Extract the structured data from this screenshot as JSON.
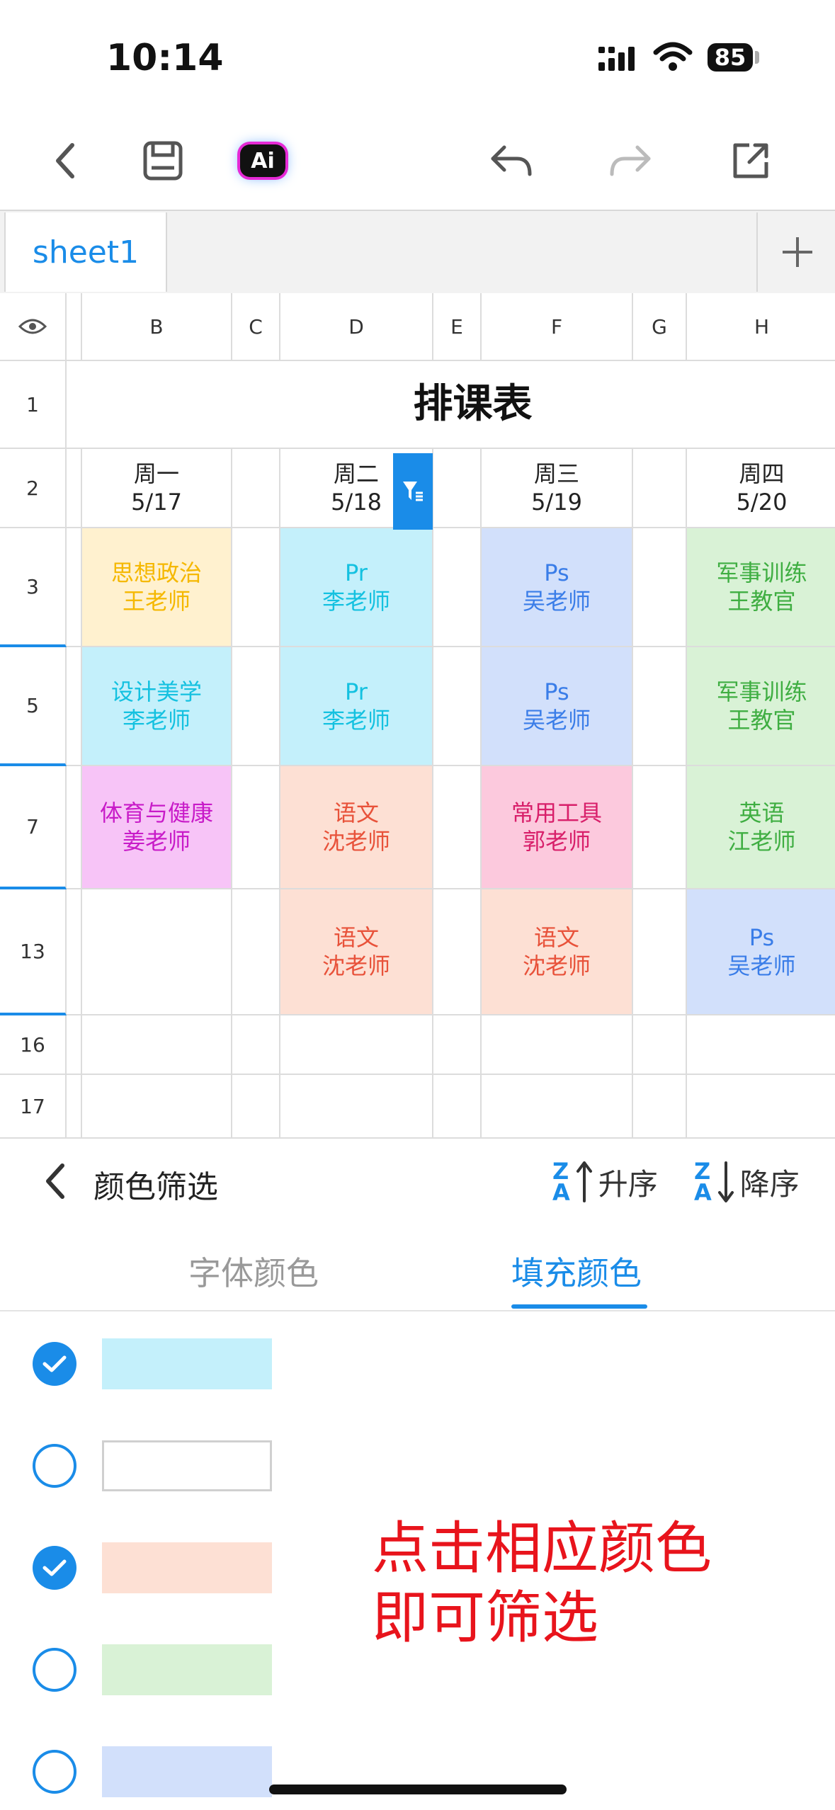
{
  "status": {
    "time": "10:14",
    "battery": "85"
  },
  "toolbar": {
    "ai_label": "Ai"
  },
  "sheet": {
    "tab_name": "sheet1"
  },
  "colors": {
    "accent": "#1a8ce8",
    "hint": "#e8141c"
  },
  "grid": {
    "columns": [
      "B",
      "C",
      "D",
      "E",
      "F",
      "G",
      "H"
    ],
    "rows": [
      "1",
      "2",
      "3",
      "5",
      "7",
      "13",
      "16",
      "17"
    ],
    "title": "排课表",
    "days": [
      {
        "day": "周一",
        "date": "5/17"
      },
      {
        "day": "周二",
        "date": "5/18"
      },
      {
        "day": "周三",
        "date": "5/19"
      },
      {
        "day": "周四",
        "date": "5/20"
      }
    ],
    "cells": {
      "r3": [
        {
          "course": "思想政治",
          "teacher": "王老师",
          "bg": "#fff1cf",
          "fg": "#f5b800"
        },
        {
          "course": "Pr",
          "teacher": "李老师",
          "bg": "#c4f0fb",
          "fg": "#14c1e0"
        },
        {
          "course": "Ps",
          "teacher": "吴老师",
          "bg": "#d2e0fb",
          "fg": "#3a7de8"
        },
        {
          "course": "军事训练",
          "teacher": "王教官",
          "bg": "#d9f2d6",
          "fg": "#3fae42"
        }
      ],
      "r5": [
        {
          "course": "设计美学",
          "teacher": "李老师",
          "bg": "#c4f0fb",
          "fg": "#14c1e0"
        },
        {
          "course": "Pr",
          "teacher": "李老师",
          "bg": "#c4f0fb",
          "fg": "#14c1e0"
        },
        {
          "course": "Ps",
          "teacher": "吴老师",
          "bg": "#d2e0fb",
          "fg": "#3a7de8"
        },
        {
          "course": "军事训练",
          "teacher": "王教官",
          "bg": "#d9f2d6",
          "fg": "#3fae42"
        }
      ],
      "r7": [
        {
          "course": "体育与健康",
          "teacher": "姜老师",
          "bg": "#f7c4f7",
          "fg": "#c81bc8"
        },
        {
          "course": "语文",
          "teacher": "沈老师",
          "bg": "#fde0d4",
          "fg": "#e8523a"
        },
        {
          "course": "常用工具",
          "teacher": "郭老师",
          "bg": "#fcc9dd",
          "fg": "#d81f6a"
        },
        {
          "course": "英语",
          "teacher": "江老师",
          "bg": "#d9f2d6",
          "fg": "#3fae42"
        }
      ],
      "r13": [
        {
          "course": "",
          "teacher": "",
          "bg": "#ffffff",
          "fg": "#333333"
        },
        {
          "course": "语文",
          "teacher": "沈老师",
          "bg": "#fde0d4",
          "fg": "#e8523a"
        },
        {
          "course": "语文",
          "teacher": "沈老师",
          "bg": "#fde0d4",
          "fg": "#e8523a"
        },
        {
          "course": "Ps",
          "teacher": "吴老师",
          "bg": "#d2e0fb",
          "fg": "#3a7de8"
        }
      ]
    }
  },
  "panel": {
    "title": "颜色筛选",
    "sort_asc": "升序",
    "sort_desc": "降序",
    "sort_icon_top": "Z",
    "sort_icon_bottom": "A",
    "tab_font": "字体颜色",
    "tab_fill": "填充颜色",
    "options": [
      {
        "color": "#c4f0fb",
        "checked": true
      },
      {
        "color": "#ffffff",
        "checked": false
      },
      {
        "color": "#fde0d4",
        "checked": true
      },
      {
        "color": "#d9f2d6",
        "checked": false
      },
      {
        "color": "#d2e0fb",
        "checked": false
      }
    ],
    "hint_line1": "点击相应颜色",
    "hint_line2": "即可筛选"
  }
}
